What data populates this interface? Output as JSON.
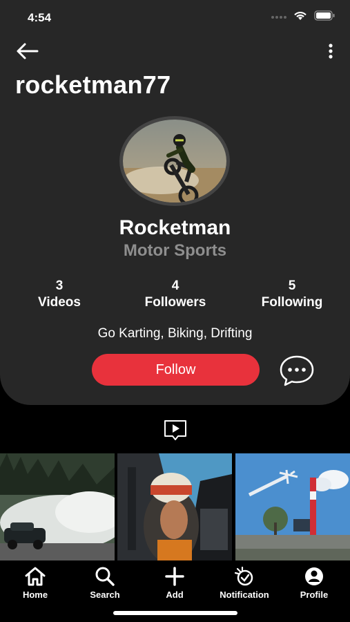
{
  "status_bar": {
    "time": "4:54"
  },
  "profile": {
    "username": "rocketman77",
    "name": "Rocketman",
    "category": "Motor Sports",
    "bio": "Go Karting, Biking, Drifting",
    "follow_label": "Follow"
  },
  "stats": [
    {
      "value": "3",
      "label": "Videos"
    },
    {
      "value": "4",
      "label": "Followers"
    },
    {
      "value": "5",
      "label": "Following"
    }
  ],
  "videos": [
    "drift-car-smoke",
    "helmet-driver",
    "air-race-pylon"
  ],
  "nav": [
    {
      "label": "Home",
      "icon": "home-icon"
    },
    {
      "label": "Search",
      "icon": "search-icon"
    },
    {
      "label": "Add",
      "icon": "plus-icon"
    },
    {
      "label": "Notification",
      "icon": "notification-icon"
    },
    {
      "label": "Profile",
      "icon": "profile-icon"
    }
  ],
  "colors": {
    "accent": "#e8323c",
    "card": "#272727",
    "muted": "#8e8e8e"
  }
}
